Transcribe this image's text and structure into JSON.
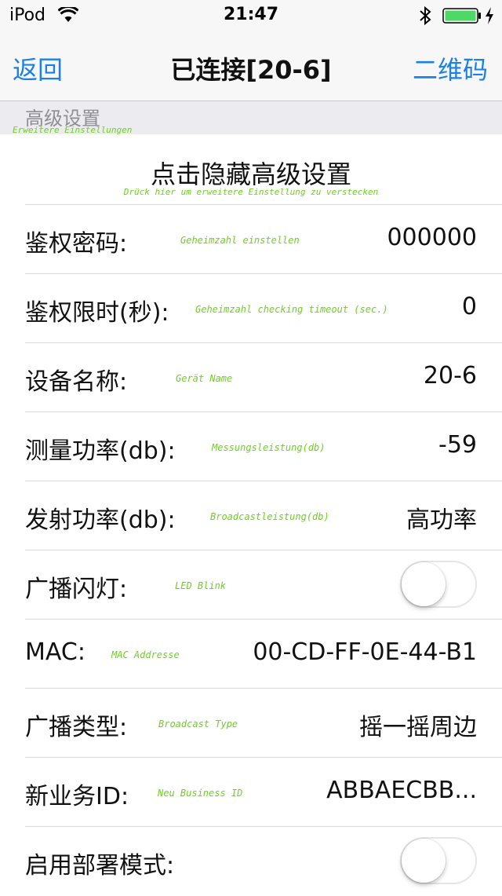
{
  "status_bar": {
    "carrier": "iPod",
    "time": "21:47",
    "wifi_icon": "wifi-icon",
    "bluetooth_icon": "bluetooth-icon",
    "battery_icon": "battery-icon",
    "charging_icon": "charging-bolt-icon",
    "battery_level": 1.0,
    "battery_color": "#4cd964"
  },
  "nav": {
    "back_label": "返回",
    "title": "已连接[20-6]",
    "action_label": "二维码",
    "accent_color": "#1a82e6"
  },
  "section": {
    "title": "高级设置",
    "subtitle": "Erweitere Einstellungen"
  },
  "toggle_advanced": {
    "title": "点击隐藏高级设置",
    "subtitle": "Drück hier um erweitere Einstellung zu verstecken"
  },
  "annotation_color": "#6ed11f",
  "rows": [
    {
      "label": "鉴权密码:",
      "sub": "Geheimzahl einstellen",
      "value": "000000"
    },
    {
      "label": "鉴权限时(秒):",
      "sub": "Geheimzahl checking timeout (sec.)",
      "value": "0"
    },
    {
      "label": "设备名称:",
      "sub": "Gerät Name",
      "value": "20-6"
    },
    {
      "label": "测量功率(db):",
      "sub": "Messungsleistung(db)",
      "value": "-59"
    },
    {
      "label": "发射功率(db):",
      "sub": "Broadcastleistung(db)",
      "value": "高功率"
    },
    {
      "label": "广播闪灯:",
      "sub": "LED Blink",
      "switch_on": false
    },
    {
      "label": "MAC:",
      "sub": "MAC Addresse",
      "value": "00-CD-FF-0E-44-B1"
    },
    {
      "label": "广播类型:",
      "sub": "Broadcast Type",
      "value": "摇一摇周边"
    },
    {
      "label": "新业务ID:",
      "sub": "Neu Business ID",
      "value": "ABBAECBB..."
    },
    {
      "label": "启用部署模式:",
      "switch_on": false
    }
  ]
}
